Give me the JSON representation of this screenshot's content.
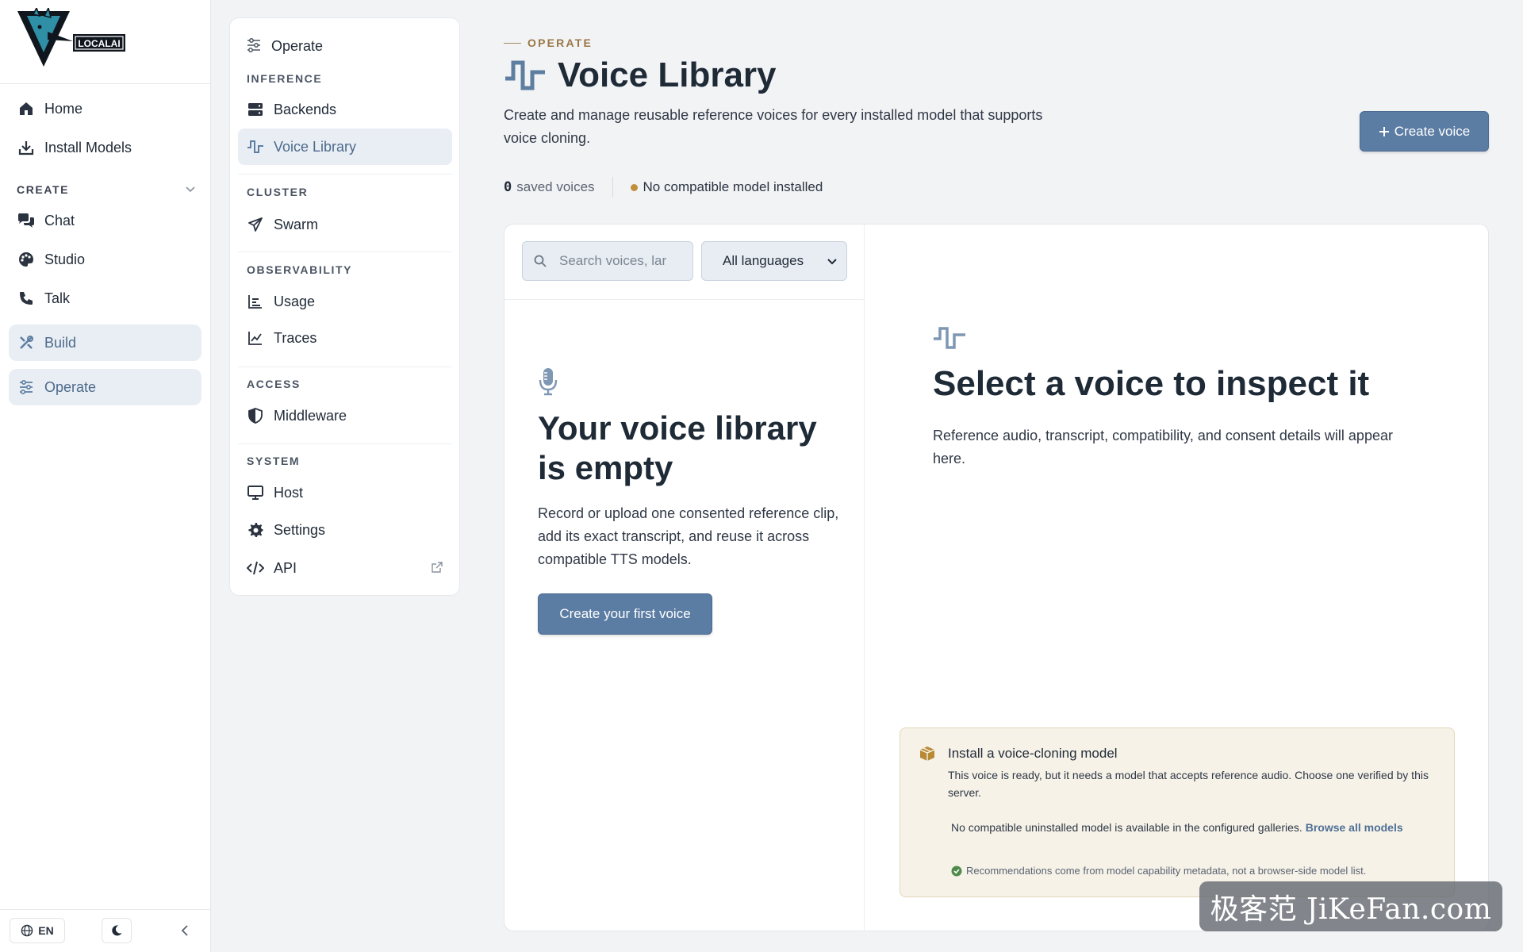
{
  "brand": {
    "logo_text": "LOCALAI"
  },
  "sidebar": {
    "items": [
      {
        "label": "Home",
        "icon": "home-icon"
      },
      {
        "label": "Install Models",
        "icon": "download-icon"
      }
    ],
    "create_section": {
      "label": "CREATE"
    },
    "create_items": [
      {
        "label": "Chat",
        "icon": "chat-icon"
      },
      {
        "label": "Studio",
        "icon": "palette-icon"
      },
      {
        "label": "Talk",
        "icon": "phone-icon"
      }
    ],
    "build": {
      "label": "Build",
      "icon": "tools-icon"
    },
    "operate": {
      "label": "Operate",
      "icon": "sliders-icon"
    },
    "footer": {
      "language": "EN"
    }
  },
  "subnav": {
    "title": "Operate",
    "sections": [
      {
        "label": "INFERENCE",
        "items": [
          {
            "label": "Backends"
          },
          {
            "label": "Voice Library",
            "active": true
          }
        ]
      },
      {
        "label": "CLUSTER",
        "items": [
          {
            "label": "Swarm"
          }
        ]
      },
      {
        "label": "OBSERVABILITY",
        "items": [
          {
            "label": "Usage"
          },
          {
            "label": "Traces"
          }
        ]
      },
      {
        "label": "ACCESS",
        "items": [
          {
            "label": "Middleware"
          }
        ]
      },
      {
        "label": "SYSTEM",
        "items": [
          {
            "label": "Host"
          },
          {
            "label": "Settings"
          },
          {
            "label": "API"
          }
        ]
      }
    ]
  },
  "header": {
    "eyebrow": "OPERATE",
    "title": "Voice Library",
    "description": "Create and manage reusable reference voices for every installed model that supports voice cloning.",
    "create_button": "Create voice"
  },
  "stats": {
    "count": "0",
    "count_label": "saved voices",
    "status": "No compatible model installed"
  },
  "colors": {
    "accent": "#5b7ca3",
    "warning_dot": "#c0903f",
    "eyebrow": "#9a7646"
  },
  "library": {
    "search_placeholder": "Search voices, lar",
    "language_filter": "All languages",
    "empty_title": "Your voice library is empty",
    "empty_description": "Record or upload one consented reference clip, add its exact transcript, and reuse it across compatible TTS models.",
    "empty_button": "Create your first voice"
  },
  "inspector": {
    "title": "Select a voice to inspect it",
    "description": "Reference audio, transcript, compatibility, and consent details will appear here."
  },
  "notice": {
    "title": "Install a voice-cloning model",
    "description": "This voice is ready, but it needs a model that accepts reference audio. Choose one verified by this server.",
    "gallery_text": "No compatible uninstalled model is available in the configured galleries.",
    "gallery_link": "Browse all models",
    "footnote": "Recommendations come from model capability metadata, not a browser-side model list."
  },
  "watermark": "极客范 JiKeFan.com"
}
